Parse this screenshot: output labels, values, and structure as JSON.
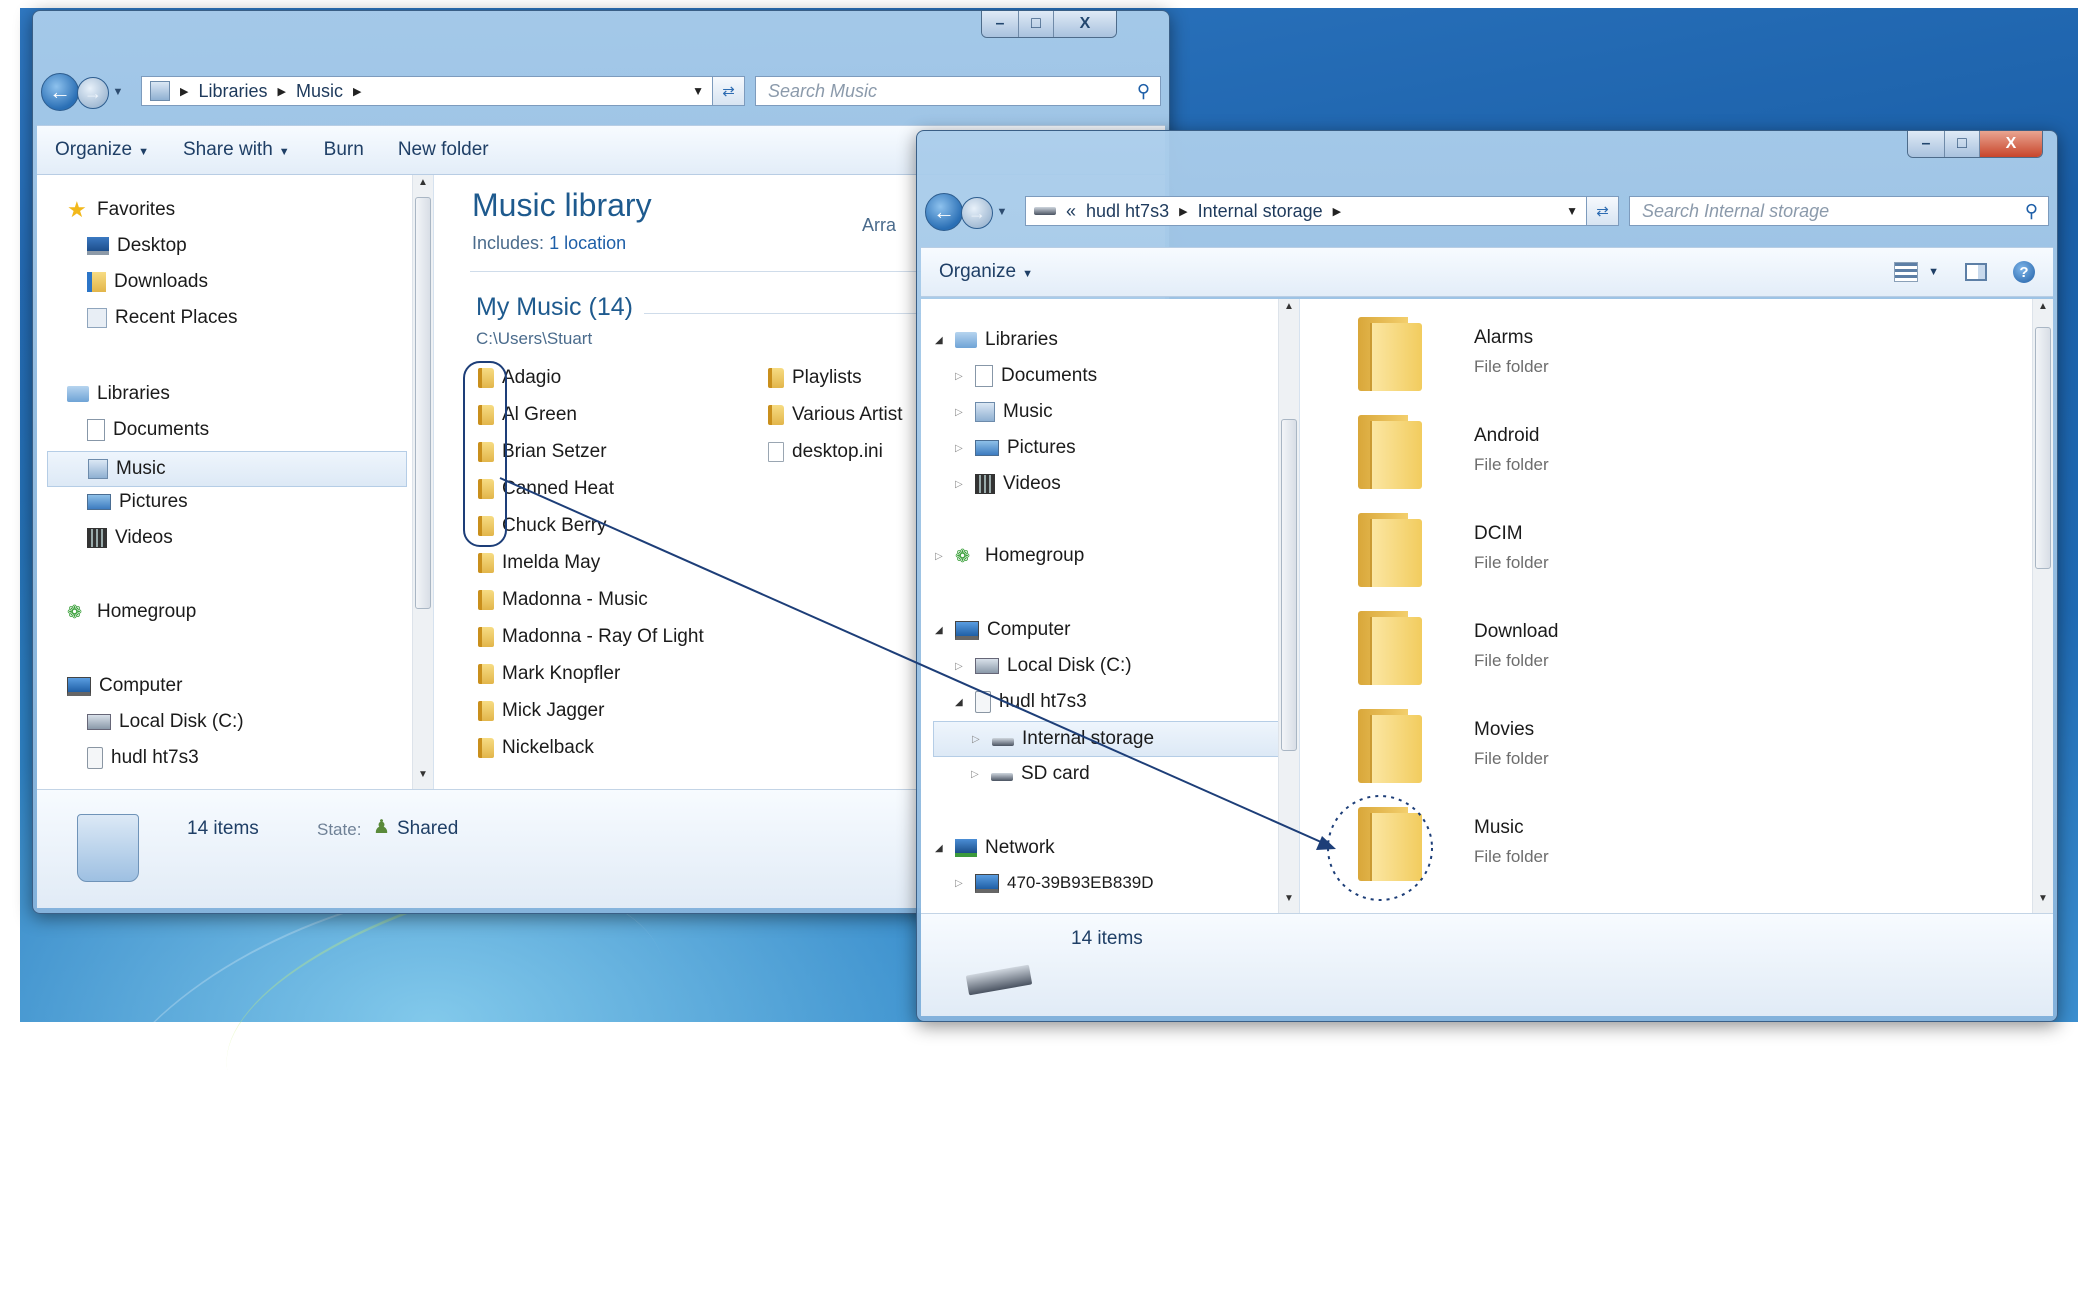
{
  "left_window": {
    "address": [
      "Libraries",
      "Music"
    ],
    "search_placeholder": "Search Music",
    "toolbar": [
      {
        "label": "Organize",
        "dropdown": true
      },
      {
        "label": "Share with",
        "dropdown": true
      },
      {
        "label": "Burn",
        "dropdown": false
      },
      {
        "label": "New folder",
        "dropdown": false
      }
    ],
    "nav": {
      "favorites": "Favorites",
      "desktop": "Desktop",
      "downloads": "Downloads",
      "recent": "Recent Places",
      "libraries": "Libraries",
      "documents": "Documents",
      "music": "Music",
      "pictures": "Pictures",
      "videos": "Videos",
      "homegroup": "Homegroup",
      "computer": "Computer",
      "local_disk": "Local Disk (C:)",
      "device": "hudl ht7s3"
    },
    "library_title": "Music library",
    "includes_label": "Includes:",
    "includes_link": "1 location",
    "arrange_label": "Arra",
    "group_title": "My Music (14)",
    "group_path": "C:\\Users\\Stuart",
    "files_col1": [
      "Adagio",
      "Al Green",
      "Brian Setzer",
      "Canned Heat",
      "Chuck Berry",
      "Imelda May",
      "Madonna - Music",
      "Madonna - Ray Of Light",
      "Mark Knopfler",
      "Mick Jagger",
      "Nickelback"
    ],
    "files_col2": [
      "Playlists",
      "Various Artist",
      "desktop.ini"
    ],
    "status_count": "14 items",
    "status_state_label": "State:",
    "status_state_value": "Shared"
  },
  "right_window": {
    "address": [
      "hudl ht7s3",
      "Internal storage"
    ],
    "address_prefix": "«",
    "search_placeholder": "Search Internal storage",
    "toolbar_organize": "Organize",
    "help_label": "?",
    "nav": {
      "libraries": "Libraries",
      "documents": "Documents",
      "music": "Music",
      "pictures": "Pictures",
      "videos": "Videos",
      "homegroup": "Homegroup",
      "computer": "Computer",
      "local_disk": "Local Disk (C:)",
      "device": "hudl ht7s3",
      "internal": "Internal storage",
      "sdcard": "SD card",
      "network": "Network",
      "network_pc": "470-39B93EB839D"
    },
    "folders": [
      {
        "name": "Alarms",
        "type": "File folder"
      },
      {
        "name": "Android",
        "type": "File folder"
      },
      {
        "name": "DCIM",
        "type": "File folder"
      },
      {
        "name": "Download",
        "type": "File folder"
      },
      {
        "name": "Movies",
        "type": "File folder"
      },
      {
        "name": "Music",
        "type": "File folder"
      }
    ],
    "status_count": "14 items"
  },
  "caption": {
    "min": "–",
    "max": "□",
    "close": "X"
  }
}
